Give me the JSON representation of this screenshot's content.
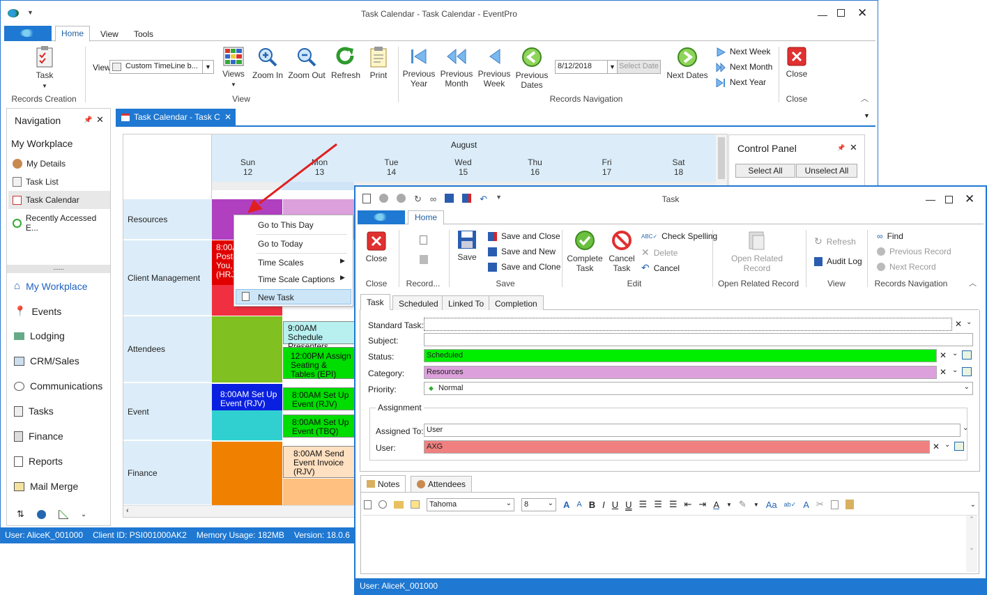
{
  "main": {
    "title": "Task Calendar - Task Calendar - EventPro",
    "tabs": [
      "Home",
      "View",
      "Tools"
    ],
    "ribbon": {
      "task_label": "Task",
      "records_creation": "Records Creation",
      "view_label": "View",
      "view_value": "Custom TimeLine b...",
      "views": "Views",
      "zoom_in": "Zoom In",
      "zoom_out": "Zoom Out",
      "refresh": "Refresh",
      "print": "Print",
      "view_group": "View",
      "prev_year_1": "Previous",
      "prev_year_2": "Year",
      "prev_month_1": "Previous",
      "prev_month_2": "Month",
      "prev_week_1": "Previous",
      "prev_week_2": "Week",
      "prev_dates_1": "Previous",
      "prev_dates_2": "Dates",
      "date_value": "8/12/2018",
      "select_date": "Select Date",
      "next_dates": "Next Dates",
      "next_week": "Next Week",
      "next_month": "Next Month",
      "next_year": "Next Year",
      "records_navigation": "Records Navigation",
      "close": "Close",
      "close_group": "Close"
    },
    "nav": {
      "header": "Navigation",
      "workplace": "My Workplace",
      "items": [
        "My Details",
        "Task List",
        "Task Calendar",
        "Recently Accessed E..."
      ],
      "big": [
        "My Workplace",
        "Events",
        "Lodging",
        "CRM/Sales",
        "Communications",
        "Tasks",
        "Finance",
        "Reports",
        "Mail Merge"
      ]
    },
    "doc_tab": "Task Calendar - Task C",
    "calendar": {
      "month": "August",
      "days": [
        {
          "d": "Sun",
          "n": "12"
        },
        {
          "d": "Mon",
          "n": "13"
        },
        {
          "d": "Tue",
          "n": "14"
        },
        {
          "d": "Wed",
          "n": "15"
        },
        {
          "d": "Thu",
          "n": "16"
        },
        {
          "d": "Fri",
          "n": "17"
        },
        {
          "d": "Sat",
          "n": "18"
        }
      ],
      "rows": [
        "Resources",
        "Client Management",
        "Attendees",
        "Event",
        "Finance"
      ],
      "appts": {
        "cm1": "8:00A",
        "cm2": "Post-",
        "cm3": "You,",
        "cm4": "(HRJ",
        "att1": "9:00AM Schedule Presenters (HRJ)",
        "att2": "12:00PM Assign Seating & Tables (EPI)",
        "ev1": "8:00AM Set Up Event (RJV)",
        "ev2": "8:00AM Set Up Event (RJV)",
        "ev3": "8:00AM Set Up Event (TBQ)",
        "fin1": "8:00AM Send Event Invoice (RJV)"
      }
    },
    "context_menu": [
      "Go to This Day",
      "Go to Today",
      "Time Scales",
      "Time Scale Captions",
      "New Task"
    ],
    "control_panel": {
      "title": "Control Panel",
      "select_all": "Select All",
      "unselect_all": "Unselect All"
    },
    "status": {
      "user": "User: AliceK_001000",
      "client": "Client ID: PSI001000AK2",
      "memory": "Memory Usage: 182MB",
      "version": "Version: 18.0.6"
    }
  },
  "task": {
    "title": "Task",
    "tab": "Home",
    "ribbon": {
      "close": "Close",
      "close_group": "Close",
      "record_group": "Record...",
      "save": "Save",
      "save_close": "Save and Close",
      "save_new": "Save and New",
      "save_clone": "Save and Clone",
      "save_group": "Save",
      "complete_1": "Complete",
      "complete_2": "Task",
      "cancel_1": "Cancel",
      "cancel_2": "Task",
      "check_spelling": "Check Spelling",
      "delete": "Delete",
      "cancel": "Cancel",
      "edit_group": "Edit",
      "open_related_1": "Open Related",
      "open_related_2": "Record",
      "open_related_group": "Open Related Record",
      "refresh": "Refresh",
      "audit_log": "Audit Log",
      "view_group": "View",
      "find": "Find",
      "prev_record": "Previous Record",
      "next_record": "Next Record",
      "nav_group": "Records Navigation"
    },
    "tabs": [
      "Task",
      "Scheduled",
      "Linked To",
      "Completion"
    ],
    "fields": {
      "standard_task": "Standard Task:",
      "subject": "Subject:",
      "status": "Status:",
      "status_value": "Scheduled",
      "category": "Category:",
      "category_value": "Resources",
      "priority": "Priority:",
      "priority_value": "Normal",
      "assignment": "Assignment",
      "assigned_to": "Assigned To:",
      "assigned_value": "User",
      "user": "User:",
      "user_value": "AXG"
    },
    "bottom_tabs": [
      "Notes",
      "Attendees"
    ],
    "font": "Tahoma",
    "size": "8",
    "status_user": "User: AliceK_001000"
  },
  "colors": {
    "accent": "#1f78d1",
    "status_green": "#00ee00",
    "category_pink": "#dca0dc",
    "user_red": "#f08080",
    "arrow": "#e02020"
  }
}
